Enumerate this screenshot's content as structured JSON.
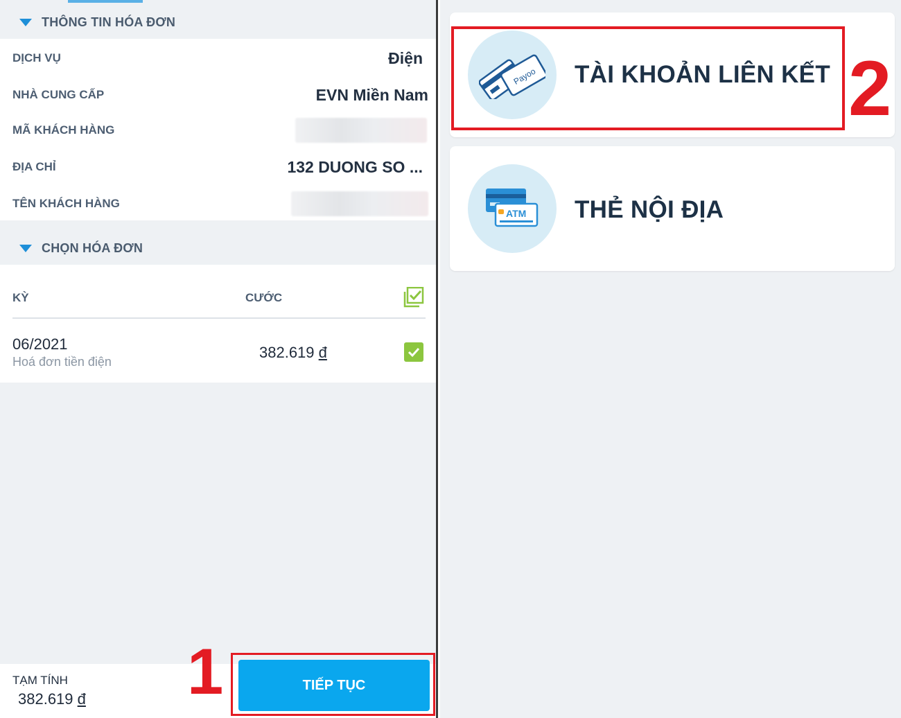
{
  "invoice_info": {
    "section_title": "THÔNG TIN HÓA ĐƠN",
    "rows": [
      {
        "label": "DỊCH VỤ",
        "value": "Điện"
      },
      {
        "label": "NHÀ CUNG CẤP",
        "value": "EVN Miền Nam"
      },
      {
        "label": "MÃ KHÁCH HÀNG",
        "value": ""
      },
      {
        "label": "ĐỊA CHỈ",
        "value": "132 DUONG SO ..."
      },
      {
        "label": "TÊN KHÁCH HÀNG",
        "value": ""
      }
    ]
  },
  "bill_select": {
    "section_title": "CHỌN HÓA ĐƠN",
    "col_period": "KỲ",
    "col_amount": "CƯỚC",
    "bill": {
      "period": "06/2021",
      "description": "Hoá đơn tiền điện",
      "amount_number": "382.619",
      "currency": "đ"
    }
  },
  "footer": {
    "subtotal_label": "TẠM TÍNH",
    "subtotal_number": "382.619",
    "currency": "đ",
    "continue_label": "TIẾP TỤC"
  },
  "step_markers": {
    "step1": "1",
    "step2": "2"
  },
  "payment_methods": [
    {
      "label": "TÀI KHOẢN LIÊN KẾT",
      "icon": "linked-cards-icon"
    },
    {
      "label": "THẺ NỘI ĐỊA",
      "icon": "atm-card-icon"
    }
  ],
  "icon_text": {
    "payoo": "Payoo",
    "atm": "ATM"
  },
  "colors": {
    "accent_blue": "#0aa7ee",
    "highlight_red": "#e31b23",
    "check_green": "#8cc63f"
  }
}
